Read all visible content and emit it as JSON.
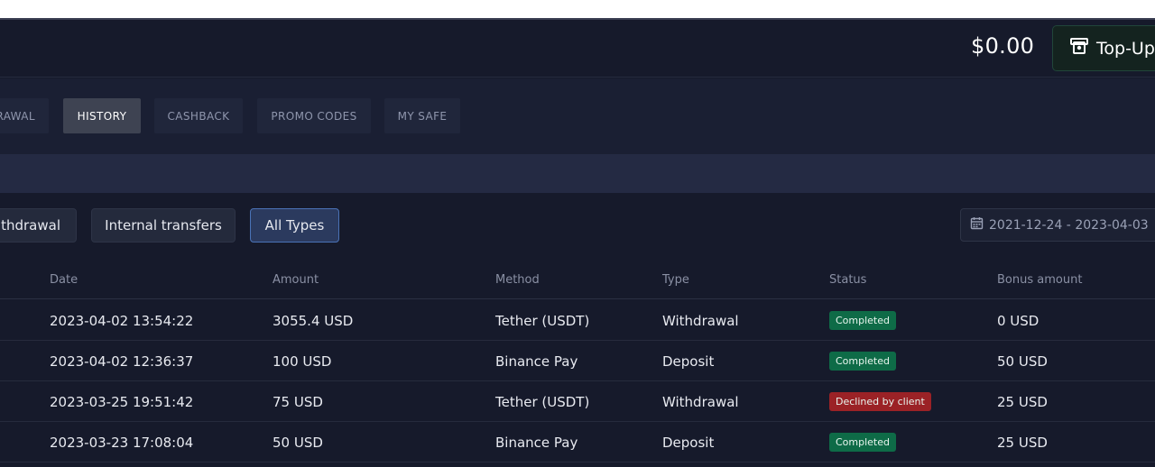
{
  "header": {
    "balance": "$0.00",
    "topup_label": "Top-Up",
    "topup_icon": "wallet-icon"
  },
  "tabs": [
    {
      "label": "WITHDRAWAL",
      "active": false
    },
    {
      "label": "HISTORY",
      "active": true
    },
    {
      "label": "CASHBACK",
      "active": false
    },
    {
      "label": "PROMO CODES",
      "active": false
    },
    {
      "label": "MY SAFE",
      "active": false
    }
  ],
  "filters": {
    "buttons": [
      {
        "label": "Withdrawal",
        "active": false
      },
      {
        "label": "Internal transfers",
        "active": false
      },
      {
        "label": "All Types",
        "active": true
      }
    ],
    "date_range": "2021-12-24 - 2023-04-03",
    "date_icon": "calendar-icon"
  },
  "table": {
    "columns": [
      "Date",
      "Amount",
      "Method",
      "Type",
      "Status",
      "Bonus amount"
    ],
    "rows": [
      {
        "date": "2023-04-02 13:54:22",
        "amount": "3055.4 USD",
        "method": "Tether (USDT)",
        "type": "Withdrawal",
        "status": "Completed",
        "status_color": "#0e6b47",
        "bonus": "0 USD"
      },
      {
        "date": "2023-04-02 12:36:37",
        "amount": "100 USD",
        "method": "Binance Pay",
        "type": "Deposit",
        "status": "Completed",
        "status_color": "#0e6b47",
        "bonus": "50 USD"
      },
      {
        "date": "2023-03-25 19:51:42",
        "amount": "75 USD",
        "method": "Tether (USDT)",
        "type": "Withdrawal",
        "status": "Declined by client",
        "status_color": "#9b2226",
        "bonus": "25 USD"
      },
      {
        "date": "2023-03-23 17:08:04",
        "amount": "50 USD",
        "method": "Binance Pay",
        "type": "Deposit",
        "status": "Completed",
        "status_color": "#0e6b47",
        "bonus": "25 USD"
      }
    ]
  },
  "colors": {
    "background": "#161a2b",
    "accent": "#4a72b6",
    "success": "#0e6b47",
    "danger": "#9b2226"
  }
}
